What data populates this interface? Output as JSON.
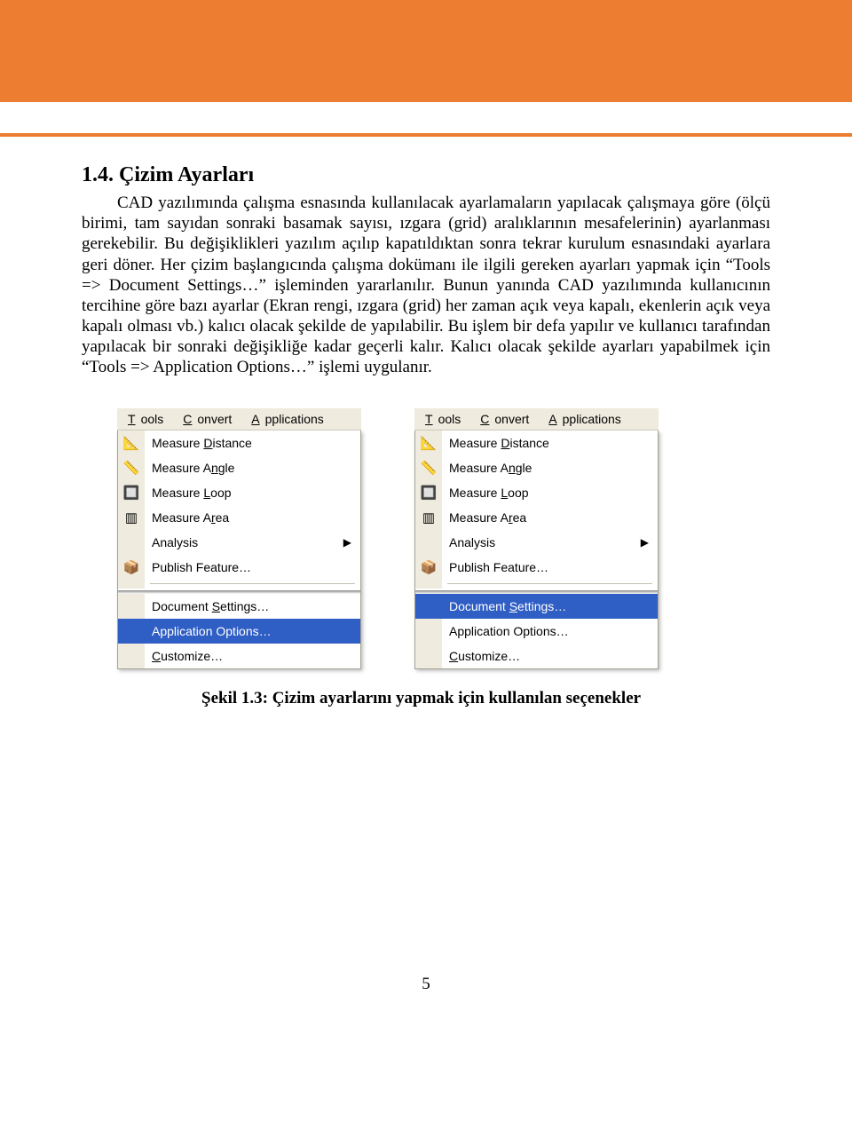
{
  "heading": "1.4. Çizim Ayarları",
  "paragraph": "CAD yazılımında çalışma esnasında kullanılacak ayarlamaların yapılacak çalışmaya göre (ölçü birimi, tam sayıdan sonraki basamak sayısı, ızgara (grid) aralıklarının mesafelerinin) ayarlanması gerekebilir. Bu değişiklikleri yazılım açılıp kapatıldıktan sonra tekrar kurulum esnasındaki ayarlara geri döner. Her çizim başlangıcında çalışma dokümanı ile ilgili gereken ayarları yapmak için “Tools => Document Settings…” işleminden yararlanılır. Bunun yanında CAD yazılımında kullanıcının tercihine göre bazı ayarlar (Ekran rengi, ızgara (grid) her zaman açık veya kapalı, ekenlerin açık veya kapalı olması vb.) kalıcı olacak şekilde de yapılabilir. Bu işlem bir defa yapılır ve kullanıcı tarafından yapılacak bir sonraki değişikliğe kadar geçerli kalır. Kalıcı olacak şekilde ayarları yapabilmek için “Tools => Application Options…” işlemi uygulanır.",
  "menubar": {
    "tools": "Tools",
    "convert": "Convert",
    "applications": "Applications"
  },
  "menu": {
    "measure_distance": "Measure Distance",
    "measure_angle": "Measure Angle",
    "measure_loop": "Measure Loop",
    "measure_area": "Measure Area",
    "analysis": "Analysis",
    "publish_feature": "Publish Feature…",
    "document_settings": "Document Settings…",
    "application_options": "Application Options…",
    "customize": "Customize…"
  },
  "icons": {
    "distance": "📐",
    "angle": "📏",
    "loop": "🔲",
    "area": "▥",
    "publish": "📦"
  },
  "caption": "Şekil 1.3: Çizim ayarlarını yapmak için kullanılan seçenekler",
  "page_number": "5"
}
